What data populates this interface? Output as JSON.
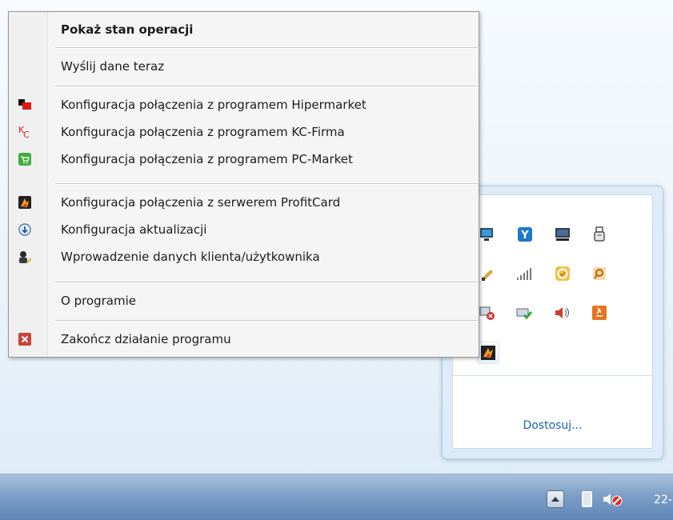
{
  "menu": {
    "items": [
      {
        "label": "Pokaż stan operacji",
        "icon": ""
      },
      {
        "label": "Wyślij dane teraz",
        "icon": ""
      },
      {
        "label": "Konfiguracja połączenia z programem Hipermarket",
        "icon": "hipermarket-icon"
      },
      {
        "label": "Konfiguracja połączenia z programem KC-Firma",
        "icon": "kc-firma-icon"
      },
      {
        "label": "Konfiguracja połączenia z programem PC-Market",
        "icon": "pc-market-icon"
      },
      {
        "label": "Konfiguracja połączenia z serwerem ProfitCard",
        "icon": "profitcard-icon"
      },
      {
        "label": "Konfiguracja aktualizacji",
        "icon": "download-icon"
      },
      {
        "label": "Wprowadzenie danych klienta/użytkownika",
        "icon": "user-pencil-icon"
      },
      {
        "label": "O programie",
        "icon": ""
      },
      {
        "label": "Zakończ działanie programu",
        "icon": "close-icon"
      }
    ]
  },
  "tray_flyout": {
    "customize_link": "Dostosuj...",
    "icons": [
      "monitor-icon",
      "network-wifi-icon",
      "display-icon",
      "usb-device-icon",
      "pen-tool-icon",
      "signal-bars-icon",
      "sync-icon",
      "key-search-icon",
      "network-error-icon",
      "network-ok-icon",
      "volume-icon",
      "java-icon",
      "profitcard-tray-icon"
    ]
  },
  "taskbar": {
    "clock": "22-",
    "icons": [
      "show-hidden-icons-button",
      "battery-icon",
      "speaker-muted-icon"
    ]
  },
  "colors": {
    "menu_bg": "#f5f5f5",
    "link": "#1d64b4",
    "taskbar": "#7e9fc6"
  }
}
